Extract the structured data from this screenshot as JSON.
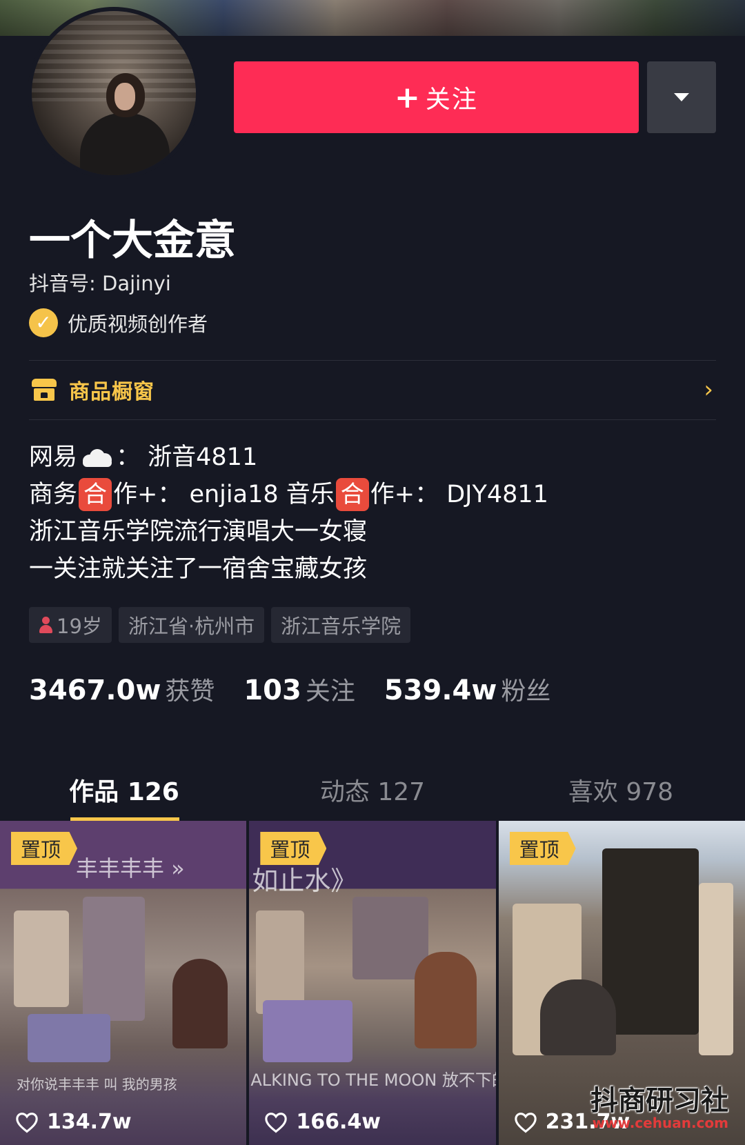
{
  "profile": {
    "follow_label": "关注",
    "nickname": "一个大金意",
    "douyin_id": "抖音号: Dajinyi",
    "verified_label": "优质视频创作者"
  },
  "shop": {
    "label": "商品橱窗"
  },
  "bio": {
    "line1_prefix": "网易",
    "line1_suffix": "：  浙音4811",
    "line2_part1": "商务",
    "line2_badge": "合",
    "line2_part2": "作+：  enjia18  音乐",
    "line2_badge2": "合",
    "line2_part3": "作+：  DJY4811",
    "line3": "浙江音乐学院流行演唱大一女寝",
    "line4": "一关注就关注了一宿舍宝藏女孩"
  },
  "tags": {
    "age": "19岁",
    "location": "浙江省·杭州市",
    "school": "浙江音乐学院"
  },
  "stats": {
    "likes_num": "3467.0w",
    "likes_label": "获赞",
    "following_num": "103",
    "following_label": "关注",
    "fans_num": "539.4w",
    "fans_label": "粉丝"
  },
  "tabs": {
    "works": "作品 126",
    "dynamics": "动态 127",
    "likes": "喜欢 978"
  },
  "videos": [
    {
      "pin": "置顶",
      "likes": "134.7w",
      "overlay_top": "丰丰丰丰 »",
      "overlay_bottom": "对你说丰丰丰  叫  我的男孩"
    },
    {
      "pin": "置顶",
      "likes": "166.4w",
      "overlay_top": "如止水》",
      "overlay_bottom": "ALKING TO THE MOON 放不下的理"
    },
    {
      "pin": "置顶",
      "likes": "231.7w"
    }
  ],
  "watermark": {
    "brand": "抖商研习社",
    "url": "www.cehuan.com"
  },
  "colors": {
    "accent": "#fe2c55",
    "gold": "#f8c64a",
    "background": "#161823"
  }
}
